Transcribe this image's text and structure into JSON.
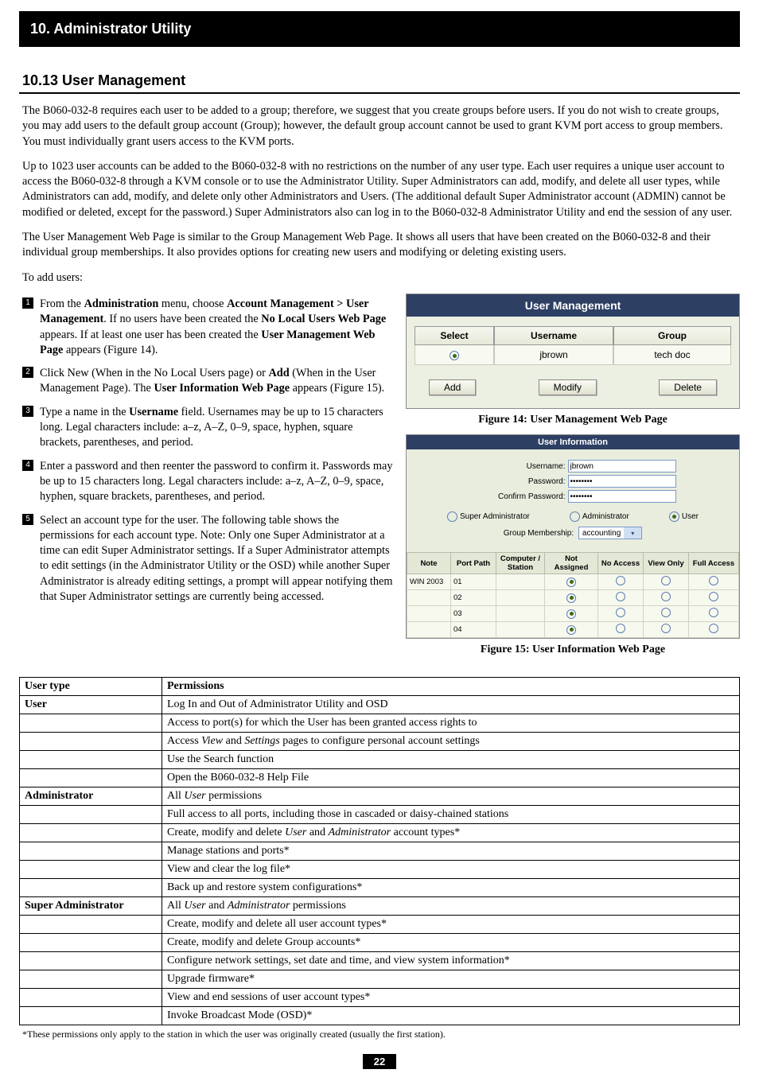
{
  "chapter_title": "10. Administrator Utility",
  "section_title": "10.13 User Management",
  "paragraphs": [
    "The B060-032-8 requires each user to be added to a group; therefore, we suggest that you create groups before users. If you do not wish to create groups, you may add users to the default group account (Group); however, the default group account cannot be used to grant KVM port access to group members. You must individually grant users access to the KVM ports.",
    "Up to 1023 user accounts can be added to the B060-032-8 with no restrictions on the number of any user type. Each user requires a unique user account to access the B060-032-8 through a KVM console or to use the Administrator Utility. Super Administrators can add, modify, and delete all user types, while Administrators can add, modify, and delete only other Administrators and Users. (The additional default Super Administrator account (ADMIN) cannot be modified or deleted, except for the password.) Super Administrators also can log in to the B060-032-8 Administrator Utility and end the session of any user.",
    "The User Management Web Page is similar to the Group Management Web Page. It shows all users that have been created on the B060-032-8 and their individual group memberships. It also provides options for creating new users and modifying or deleting existing users."
  ],
  "to_add_users": "To add users:",
  "steps": {
    "s1_a": "From the ",
    "s1_b": "Administration",
    "s1_c": " menu, choose ",
    "s1_d": "Account Management > User Management",
    "s1_e": ". If no users have been created the ",
    "s1_f": "No Local Users Web Page",
    "s1_g": " appears. If at least one user has been created the ",
    "s1_h": "User Management Web Page",
    "s1_i": " appears (Figure 14).",
    "s2_a": "Click New (When in the No Local Users page) or ",
    "s2_b": "Add",
    "s2_c": " (When in the User Management Page). The ",
    "s2_d": "User Information Web Page",
    "s2_e": " appears (Figure 15).",
    "s3_a": "Type a name in the ",
    "s3_b": "Username",
    "s3_c": " field. Usernames may be up to 15 characters long. Legal characters include: a–z, A–Z, 0–9, space, hyphen, square brackets, parentheses, and period.",
    "s4": "Enter a password and then reenter the password to confirm it. Passwords may be up to 15 characters long. Legal characters include: a–z, A–Z, 0–9, space, hyphen, square brackets, parentheses, and period.",
    "s5": "Select an account type for the user. The following table shows the permissions for each account type. Note: Only one Super Administrator at a time can edit Super Administrator settings. If a Super Administrator attempts to edit settings (in the Administrator Utility or the OSD) while another Super Administrator is already editing settings, a prompt will appear notifying them that Super Administrator settings are currently being accessed."
  },
  "fig14": {
    "caption": "Figure 14: User Management Web Page",
    "title": "User Management",
    "headers": {
      "select": "Select",
      "username": "Username",
      "group": "Group"
    },
    "row": {
      "username": "jbrown",
      "group": "tech doc"
    },
    "buttons": {
      "add": "Add",
      "modify": "Modify",
      "delete": "Delete"
    }
  },
  "fig15": {
    "caption": "Figure 15: User Information Web Page",
    "title": "User Information",
    "labels": {
      "username": "Username:",
      "password": "Password:",
      "confirm": "Confirm Password:",
      "group_membership": "Group Membership:"
    },
    "values": {
      "username": "jbrown",
      "password": "••••••••",
      "confirm": "••••••••",
      "group": "accounting"
    },
    "roles": {
      "super": "Super Administrator",
      "admin": "Administrator",
      "user": "User"
    },
    "table_headers": {
      "note": "Note",
      "portpath": "Port Path",
      "station": "Computer / Station",
      "na": "Not Assigned",
      "noacc": "No Access",
      "vo": "View Only",
      "fa": "Full Access"
    },
    "rows": [
      {
        "note": "WIN 2003",
        "port": "01"
      },
      {
        "note": "",
        "port": "02"
      },
      {
        "note": "",
        "port": "03"
      },
      {
        "note": "",
        "port": "04"
      }
    ]
  },
  "perm_table": {
    "header": {
      "type": "User type",
      "perm": "Permissions"
    },
    "user_label": "User",
    "user_rows": [
      "Log In and Out of Administrator Utility and OSD",
      "Access to port(s) for which the User has been granted access rights to",
      "Access View and Settings pages to configure personal account settings",
      "Use the Search function",
      "Open the B060-032-8 Help File"
    ],
    "admin_label": "Administrator",
    "admin_rows": [
      "All User permissions",
      "Full access to all ports, including those in cascaded or daisy-chained stations",
      "Create, modify and delete User and Administrator account types*",
      "Manage stations and ports*",
      "View and clear the log file*",
      "Back up and restore system configurations*"
    ],
    "super_label": "Super Administrator",
    "super_rows": [
      "All User and Administrator permissions",
      "Create, modify and delete all user account types*",
      "Create, modify and delete Group accounts*",
      "Configure network settings, set date and time, and view system information*",
      "Upgrade firmware*",
      "View and end sessions of user account types*",
      "Invoke Broadcast Mode (OSD)*"
    ]
  },
  "footnote": "*These permissions only apply to the station in which the user was originally created (usually the first station).",
  "page_number": "22"
}
